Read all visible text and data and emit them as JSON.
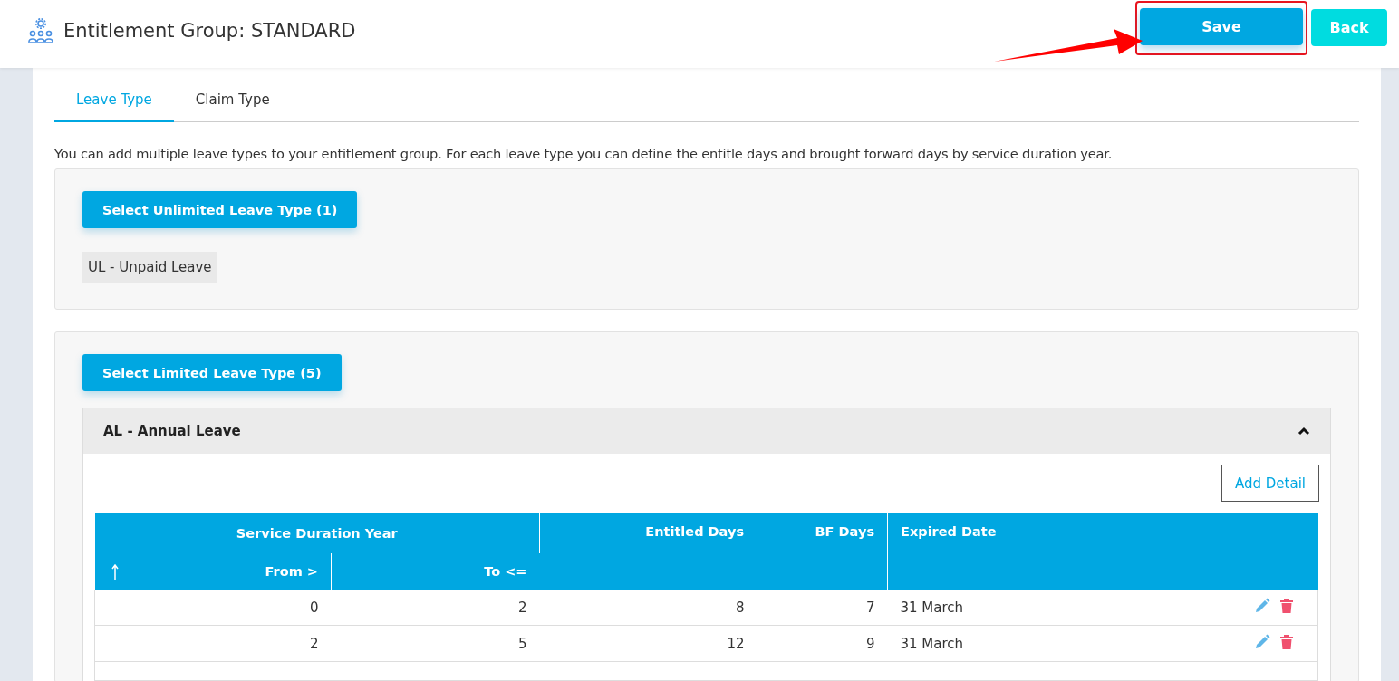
{
  "header": {
    "title": "Entitlement Group: STANDARD",
    "buttons": [
      {
        "label": "Save",
        "kind": "primary",
        "highlighted": true
      },
      {
        "label": "Back",
        "kind": "secondary",
        "highlighted": false
      }
    ]
  },
  "tabs": [
    {
      "label": "Leave Type",
      "selected": true
    },
    {
      "label": "Claim Type",
      "selected": false
    }
  ],
  "description": "You can add multiple leave types to your entitlement group. For each leave type you can define the entitle days and brought forward days by service duration year.",
  "unlimited": {
    "button": "Select Unlimited Leave Type (1)",
    "items": [
      "UL - Unpaid Leave"
    ]
  },
  "limited": {
    "button": "Select Limited Leave Type (5)",
    "groups": [
      {
        "title": "AL - Annual Leave",
        "expanded": true,
        "add_button": "Add Detail",
        "table": {
          "group_header": "Service Duration Year",
          "columns": [
            "From >",
            "To <=",
            "Entitled Days",
            "BF Days",
            "Expired Date"
          ],
          "rows": [
            {
              "from": "0",
              "to": "2",
              "entitled": "8",
              "bf": "7",
              "expired": "31 March"
            },
            {
              "from": "2",
              "to": "5",
              "entitled": "12",
              "bf": "9",
              "expired": "31 March"
            }
          ]
        }
      }
    ]
  }
}
